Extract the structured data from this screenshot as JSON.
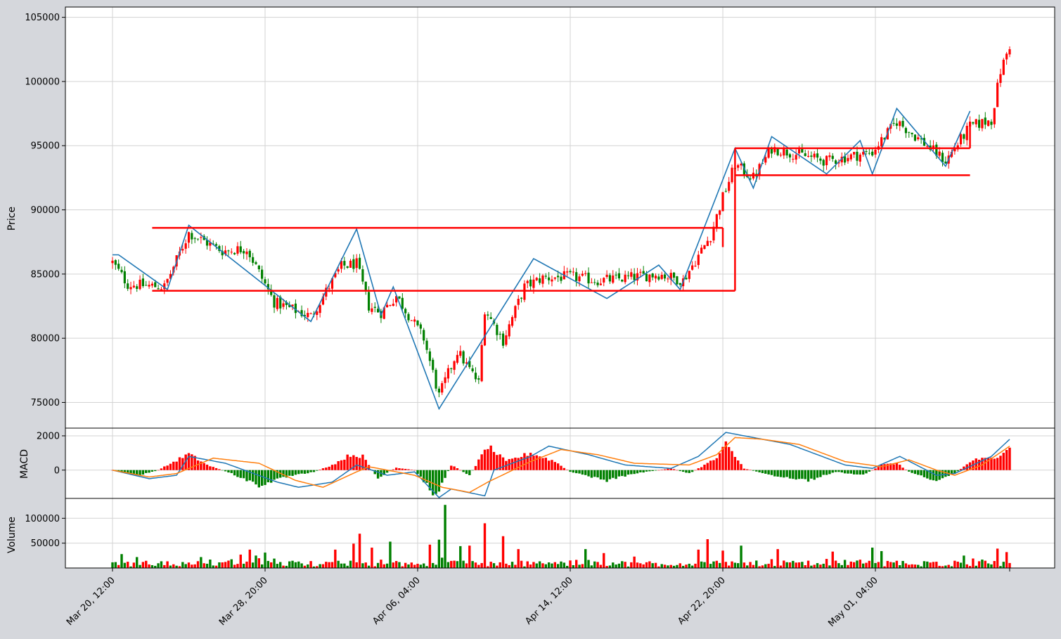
{
  "chart_data": {
    "type": "candlestick",
    "title": "",
    "x_ticks": [
      "Mar 20, 12:00",
      "Mar 28, 20:00",
      "Apr 06, 04:00",
      "Apr 14, 12:00",
      "Apr 22, 20:00",
      "May 01, 04:00"
    ],
    "price_panel": {
      "ylabel": "Price",
      "y_ticks": [
        75000,
        80000,
        85000,
        90000,
        95000,
        100000,
        105000
      ],
      "ylim": [
        73000,
        105800
      ],
      "zigzag_pivots": [
        {
          "date": "Mar 20, 12:00",
          "value": 86500
        },
        {
          "date": "Mar 20, 20:00",
          "value": 86500
        },
        {
          "date": "Mar 23, 12:00",
          "value": 83800
        },
        {
          "date": "Mar 24, 16:00",
          "value": 88800
        },
        {
          "date": "Mar 31, 08:00",
          "value": 81300
        },
        {
          "date": "Apr 02, 20:00",
          "value": 88500
        },
        {
          "date": "Apr 04, 04:00",
          "value": 81800
        },
        {
          "date": "Apr 04, 20:00",
          "value": 84000
        },
        {
          "date": "Apr 07, 08:00",
          "value": 74500
        },
        {
          "date": "Apr 12, 12:00",
          "value": 86200
        },
        {
          "date": "Apr 16, 12:00",
          "value": 83100
        },
        {
          "date": "Apr 19, 08:00",
          "value": 85700
        },
        {
          "date": "Apr 20, 12:00",
          "value": 83800
        },
        {
          "date": "Apr 23, 12:00",
          "value": 94800
        },
        {
          "date": "Apr 24, 12:00",
          "value": 91700
        },
        {
          "date": "Apr 25, 12:00",
          "value": 95700
        },
        {
          "date": "Apr 28, 12:00",
          "value": 92800
        },
        {
          "date": "Apr 30, 08:00",
          "value": 95400
        },
        {
          "date": "May 01, 00:00",
          "value": 92800
        },
        {
          "date": "May 02, 08:00",
          "value": 97900
        },
        {
          "date": "May 05, 00:00",
          "value": 93400
        },
        {
          "date": "May 06, 08:00",
          "value": 97700
        }
      ],
      "range_lines": [
        {
          "from": "Mar 22, 16:00",
          "to": "Apr 22, 20:00",
          "value": 88600
        },
        {
          "from": "Mar 22, 16:00",
          "to": "Apr 23, 12:00",
          "value": 83700
        },
        {
          "from": "Apr 23, 12:00",
          "to": "May 06, 08:00",
          "value": 94800
        },
        {
          "from": "Apr 23, 12:00",
          "to": "May 06, 08:00",
          "value": 92700
        }
      ],
      "close_anchors": [
        {
          "date": "Mar 20, 12:00",
          "value": 85900
        },
        {
          "date": "Mar 21, 08:00",
          "value": 84200
        },
        {
          "date": "Mar 23, 08:00",
          "value": 84000
        },
        {
          "date": "Mar 24, 16:00",
          "value": 88200
        },
        {
          "date": "Mar 26, 12:00",
          "value": 86800
        },
        {
          "date": "Mar 27, 20:00",
          "value": 87000
        },
        {
          "date": "Mar 29, 08:00",
          "value": 82800
        },
        {
          "date": "Mar 31, 08:00",
          "value": 81700
        },
        {
          "date": "Apr 02, 00:00",
          "value": 85600
        },
        {
          "date": "Apr 02, 20:00",
          "value": 85800
        },
        {
          "date": "Apr 03, 12:00",
          "value": 82500
        },
        {
          "date": "Apr 04, 04:00",
          "value": 82000
        },
        {
          "date": "Apr 05, 00:00",
          "value": 83300
        },
        {
          "date": "Apr 06, 12:00",
          "value": 80000
        },
        {
          "date": "Apr 07, 08:00",
          "value": 75500
        },
        {
          "date": "Apr 08, 08:00",
          "value": 79000
        },
        {
          "date": "Apr 09, 12:00",
          "value": 76500
        },
        {
          "date": "Apr 09, 20:00",
          "value": 82300
        },
        {
          "date": "Apr 10, 20:00",
          "value": 79800
        },
        {
          "date": "Apr 12, 00:00",
          "value": 84000
        },
        {
          "date": "Apr 13, 00:00",
          "value": 84700
        },
        {
          "date": "Apr 14, 12:00",
          "value": 84800
        },
        {
          "date": "Apr 16, 00:00",
          "value": 84500
        },
        {
          "date": "Apr 17, 00:00",
          "value": 84600
        },
        {
          "date": "Apr 19, 08:00",
          "value": 85000
        },
        {
          "date": "Apr 20, 16:00",
          "value": 84500
        },
        {
          "date": "Apr 22, 04:00",
          "value": 88000
        },
        {
          "date": "Apr 22, 20:00",
          "value": 91000
        },
        {
          "date": "Apr 23, 12:00",
          "value": 93500
        },
        {
          "date": "Apr 24, 12:00",
          "value": 92500
        },
        {
          "date": "Apr 25, 12:00",
          "value": 94800
        },
        {
          "date": "Apr 28, 12:00",
          "value": 93800
        },
        {
          "date": "May 01, 00:00",
          "value": 94500
        },
        {
          "date": "May 02, 08:00",
          "value": 96900
        },
        {
          "date": "May 04, 00:00",
          "value": 95000
        },
        {
          "date": "May 05, 00:00",
          "value": 93800
        },
        {
          "date": "May 06, 08:00",
          "value": 96500
        },
        {
          "date": "May 07, 12:00",
          "value": 97000
        },
        {
          "date": "May 08, 00:00",
          "value": 100800
        },
        {
          "date": "May 08, 12:00",
          "value": 102800
        }
      ]
    },
    "macd_panel": {
      "ylabel": "MACD",
      "y_ticks": [
        0,
        2000
      ],
      "ylim": [
        -1650,
        2450
      ],
      "macd_line_anchors": [
        {
          "date": "Mar 20, 12:00",
          "value": 0
        },
        {
          "date": "Mar 22, 12:00",
          "value": -500
        },
        {
          "date": "Mar 24, 00:00",
          "value": -300
        },
        {
          "date": "Mar 24, 16:00",
          "value": 800
        },
        {
          "date": "Mar 26, 16:00",
          "value": 400
        },
        {
          "date": "Mar 29, 12:00",
          "value": -700
        },
        {
          "date": "Mar 30, 16:00",
          "value": -1000
        },
        {
          "date": "Apr 01, 12:00",
          "value": -700
        },
        {
          "date": "Apr 02, 20:00",
          "value": 300
        },
        {
          "date": "Apr 04, 12:00",
          "value": -300
        },
        {
          "date": "Apr 06, 00:00",
          "value": -100
        },
        {
          "date": "Apr 07, 08:00",
          "value": -1600
        },
        {
          "date": "Apr 08, 00:00",
          "value": -1100
        },
        {
          "date": "Apr 09, 20:00",
          "value": -1500
        },
        {
          "date": "Apr 10, 08:00",
          "value": 0
        },
        {
          "date": "Apr 12, 08:00",
          "value": 800
        },
        {
          "date": "Apr 13, 08:00",
          "value": 1400
        },
        {
          "date": "Apr 15, 12:00",
          "value": 900
        },
        {
          "date": "Apr 17, 12:00",
          "value": 300
        },
        {
          "date": "Apr 20, 00:00",
          "value": 100
        },
        {
          "date": "Apr 21, 12:00",
          "value": 800
        },
        {
          "date": "Apr 23, 00:00",
          "value": 2200
        },
        {
          "date": "Apr 24, 12:00",
          "value": 1900
        },
        {
          "date": "Apr 26, 12:00",
          "value": 1500
        },
        {
          "date": "Apr 29, 12:00",
          "value": 300
        },
        {
          "date": "May 01, 00:00",
          "value": 100
        },
        {
          "date": "May 02, 12:00",
          "value": 800
        },
        {
          "date": "May 04, 12:00",
          "value": -300
        },
        {
          "date": "May 05, 12:00",
          "value": -200
        },
        {
          "date": "May 07, 12:00",
          "value": 800
        },
        {
          "date": "May 08, 12:00",
          "value": 1800
        }
      ],
      "signal_line_anchors": [
        {
          "date": "Mar 20, 12:00",
          "value": 0
        },
        {
          "date": "Mar 22, 12:00",
          "value": -400
        },
        {
          "date": "Mar 24, 00:00",
          "value": -200
        },
        {
          "date": "Mar 26, 00:00",
          "value": 700
        },
        {
          "date": "Mar 28, 12:00",
          "value": 400
        },
        {
          "date": "Mar 30, 12:00",
          "value": -600
        },
        {
          "date": "Apr 01, 00:00",
          "value": -1000
        },
        {
          "date": "Apr 02, 20:00",
          "value": -100
        },
        {
          "date": "Apr 03, 12:00",
          "value": 200
        },
        {
          "date": "Apr 06, 00:00",
          "value": -300
        },
        {
          "date": "Apr 07, 12:00",
          "value": -1000
        },
        {
          "date": "Apr 09, 00:00",
          "value": -1300
        },
        {
          "date": "Apr 10, 00:00",
          "value": -700
        },
        {
          "date": "Apr 12, 08:00",
          "value": 500
        },
        {
          "date": "Apr 14, 00:00",
          "value": 1200
        },
        {
          "date": "Apr 16, 00:00",
          "value": 900
        },
        {
          "date": "Apr 18, 00:00",
          "value": 400
        },
        {
          "date": "Apr 21, 00:00",
          "value": 300
        },
        {
          "date": "Apr 22, 12:00",
          "value": 900
        },
        {
          "date": "Apr 23, 12:00",
          "value": 1900
        },
        {
          "date": "Apr 25, 00:00",
          "value": 1800
        },
        {
          "date": "Apr 27, 00:00",
          "value": 1500
        },
        {
          "date": "Apr 29, 12:00",
          "value": 500
        },
        {
          "date": "May 01, 12:00",
          "value": 200
        },
        {
          "date": "May 03, 00:00",
          "value": 600
        },
        {
          "date": "May 04, 12:00",
          "value": 0
        },
        {
          "date": "May 05, 12:00",
          "value": -300
        },
        {
          "date": "May 07, 00:00",
          "value": 300
        },
        {
          "date": "May 08, 12:00",
          "value": 1400
        }
      ],
      "histogram_anchors": [
        {
          "date": "Mar 20, 12:00",
          "value": 0
        },
        {
          "date": "Mar 22, 00:00",
          "value": -300
        },
        {
          "date": "Mar 23, 00:00",
          "value": 0
        },
        {
          "date": "Mar 24, 16:00",
          "value": 950
        },
        {
          "date": "Mar 25, 16:00",
          "value": 300
        },
        {
          "date": "Mar 27, 00:00",
          "value": -200
        },
        {
          "date": "Mar 28, 12:00",
          "value": -900
        },
        {
          "date": "Mar 30, 00:00",
          "value": -400
        },
        {
          "date": "Mar 31, 12:00",
          "value": -100
        },
        {
          "date": "Apr 01, 12:00",
          "value": 300
        },
        {
          "date": "Apr 02, 12:00",
          "value": 900
        },
        {
          "date": "Apr 03, 04:00",
          "value": 800
        },
        {
          "date": "Apr 04, 00:00",
          "value": -500
        },
        {
          "date": "Apr 05, 00:00",
          "value": 150
        },
        {
          "date": "Apr 06, 00:00",
          "value": 0
        },
        {
          "date": "Apr 07, 04:00",
          "value": -1500
        },
        {
          "date": "Apr 08, 00:00",
          "value": 300
        },
        {
          "date": "Apr 09, 00:00",
          "value": -300
        },
        {
          "date": "Apr 10, 00:00",
          "value": 1400
        },
        {
          "date": "Apr 11, 00:00",
          "value": 500
        },
        {
          "date": "Apr 12, 08:00",
          "value": 1000
        },
        {
          "date": "Apr 13, 16:00",
          "value": 500
        },
        {
          "date": "Apr 14, 12:00",
          "value": -100
        },
        {
          "date": "Apr 16, 12:00",
          "value": -600
        },
        {
          "date": "Apr 18, 00:00",
          "value": -200
        },
        {
          "date": "Apr 20, 00:00",
          "value": 100
        },
        {
          "date": "Apr 21, 00:00",
          "value": -200
        },
        {
          "date": "Apr 22, 12:00",
          "value": 700
        },
        {
          "date": "Apr 23, 00:00",
          "value": 1500
        },
        {
          "date": "Apr 24, 00:00",
          "value": 100
        },
        {
          "date": "Apr 25, 12:00",
          "value": -300
        },
        {
          "date": "Apr 27, 12:00",
          "value": -600
        },
        {
          "date": "Apr 29, 00:00",
          "value": -100
        },
        {
          "date": "Apr 30, 12:00",
          "value": -300
        },
        {
          "date": "May 01, 12:00",
          "value": 300
        },
        {
          "date": "May 02, 08:00",
          "value": 400
        },
        {
          "date": "May 03, 00:00",
          "value": -100
        },
        {
          "date": "May 04, 12:00",
          "value": -600
        },
        {
          "date": "May 05, 12:00",
          "value": -200
        },
        {
          "date": "May 06, 12:00",
          "value": 600
        },
        {
          "date": "May 07, 16:00",
          "value": 700
        },
        {
          "date": "May 08, 12:00",
          "value": 1400
        }
      ]
    },
    "volume_panel": {
      "ylabel": "Volume",
      "y_ticks": [
        50000,
        100000
      ],
      "ylim": [
        0,
        140000
      ],
      "spikes": [
        {
          "date": "Mar 21, 00:00",
          "value": 28000
        },
        {
          "date": "Mar 21, 20:00",
          "value": 22000
        },
        {
          "date": "Mar 25, 08:00",
          "value": 22000
        },
        {
          "date": "Mar 27, 12:00",
          "value": 27000
        },
        {
          "date": "Mar 28, 00:00",
          "value": 37000
        },
        {
          "date": "Mar 28, 08:00",
          "value": 25000
        },
        {
          "date": "Mar 28, 20:00",
          "value": 31000
        },
        {
          "date": "Apr 01, 16:00",
          "value": 37000
        },
        {
          "date": "Apr 02, 16:00",
          "value": 49000
        },
        {
          "date": "Apr 03, 00:00",
          "value": 69000
        },
        {
          "date": "Apr 03, 16:00",
          "value": 41000
        },
        {
          "date": "Apr 04, 16:00",
          "value": 53000
        },
        {
          "date": "Apr 06, 20:00",
          "value": 47000
        },
        {
          "date": "Apr 07, 08:00",
          "value": 57000
        },
        {
          "date": "Apr 07, 16:00",
          "value": 127000
        },
        {
          "date": "Apr 08, 12:00",
          "value": 44000
        },
        {
          "date": "Apr 09, 00:00",
          "value": 45000
        },
        {
          "date": "Apr 09, 20:00",
          "value": 90000
        },
        {
          "date": "Apr 10, 20:00",
          "value": 64000
        },
        {
          "date": "Apr 11, 16:00",
          "value": 38000
        },
        {
          "date": "Apr 15, 08:00",
          "value": 38000
        },
        {
          "date": "Apr 16, 08:00",
          "value": 30000
        },
        {
          "date": "Apr 18, 00:00",
          "value": 23000
        },
        {
          "date": "Apr 21, 12:00",
          "value": 37000
        },
        {
          "date": "Apr 22, 00:00",
          "value": 58000
        },
        {
          "date": "Apr 22, 20:00",
          "value": 35000
        },
        {
          "date": "Apr 23, 20:00",
          "value": 45000
        },
        {
          "date": "Apr 25, 20:00",
          "value": 38000
        },
        {
          "date": "Apr 28, 20:00",
          "value": 33000
        },
        {
          "date": "May 01, 00:00",
          "value": 41000
        },
        {
          "date": "May 01, 12:00",
          "value": 34000
        },
        {
          "date": "May 06, 00:00",
          "value": 25000
        },
        {
          "date": "May 07, 20:00",
          "value": 39000
        },
        {
          "date": "May 08, 08:00",
          "value": 32000
        }
      ]
    },
    "colors": {
      "up": "#ff0000",
      "down": "#008000",
      "zigzag": "#1f77b4",
      "range_line": "#ff0000",
      "macd_line": "#1f77b4",
      "signal_line": "#ff7f0e",
      "grid": "#d3d3d3"
    },
    "grid": true
  }
}
